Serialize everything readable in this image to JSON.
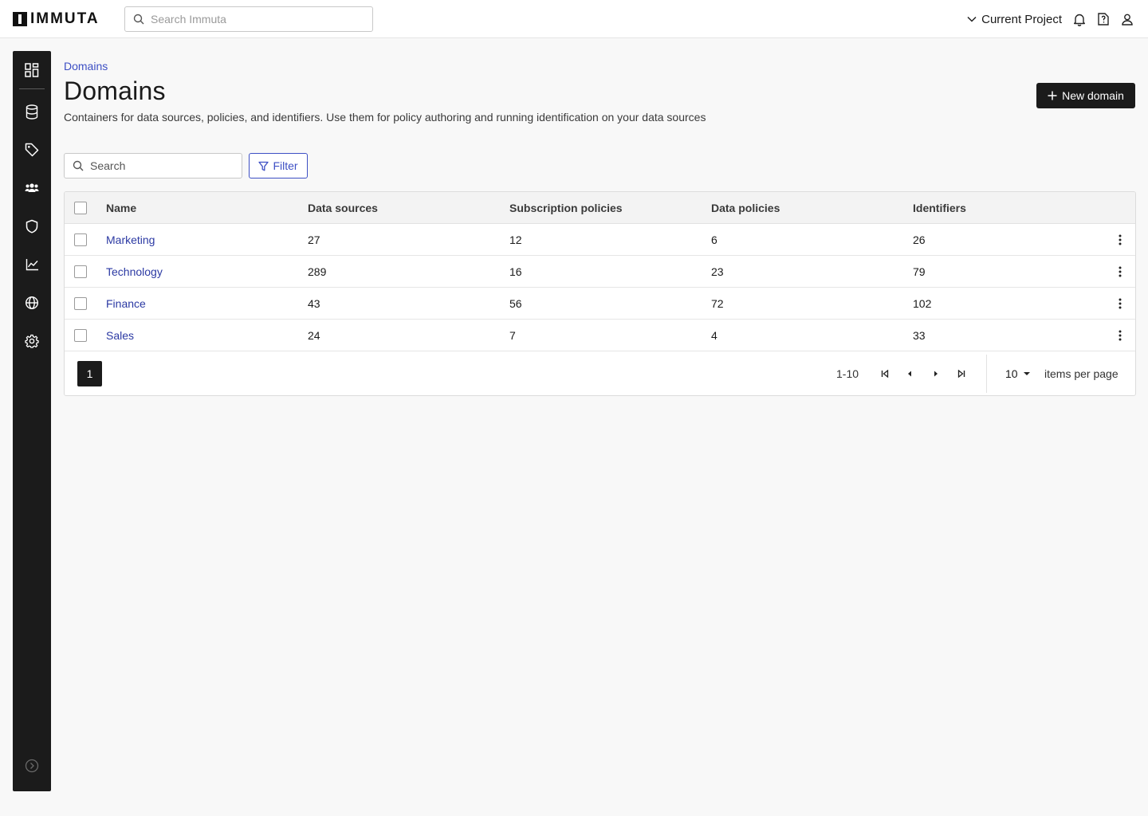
{
  "app": {
    "logo_text": "IMMUTA"
  },
  "topbar": {
    "search_placeholder": "Search Immuta",
    "project_label": "Current Project"
  },
  "breadcrumb": "Domains",
  "page": {
    "title": "Domains",
    "description": "Containers for data sources, policies, and identifiers. Use them for policy authoring and running identification on your data sources",
    "new_button": "New domain"
  },
  "toolbar": {
    "search_placeholder": "Search",
    "filter_label": "Filter"
  },
  "table": {
    "columns": [
      "Name",
      "Data sources",
      "Subscription policies",
      "Data policies",
      "Identifiers"
    ],
    "rows": [
      {
        "name": "Marketing",
        "data_sources": "27",
        "subscription_policies": "12",
        "data_policies": "6",
        "identifiers": "26"
      },
      {
        "name": "Technology",
        "data_sources": "289",
        "subscription_policies": "16",
        "data_policies": "23",
        "identifiers": "79"
      },
      {
        "name": "Finance",
        "data_sources": "43",
        "subscription_policies": "56",
        "data_policies": "72",
        "identifiers": "102"
      },
      {
        "name": "Sales",
        "data_sources": "24",
        "subscription_policies": "7",
        "data_policies": "4",
        "identifiers": "33"
      }
    ]
  },
  "pagination": {
    "current_page": "1",
    "range": "1-10",
    "per_page": "10",
    "per_page_label": "items per page"
  },
  "sidebar": {
    "items": [
      "dashboard-icon",
      "database-icon",
      "tag-icon",
      "people-icon",
      "shield-icon",
      "chart-icon",
      "globe-icon",
      "gear-icon"
    ],
    "expand": "expand-chevron-icon"
  },
  "colors": {
    "link": "#2b39a3",
    "accent": "#3d4fc4",
    "nav_bg": "#1b1b1b"
  }
}
